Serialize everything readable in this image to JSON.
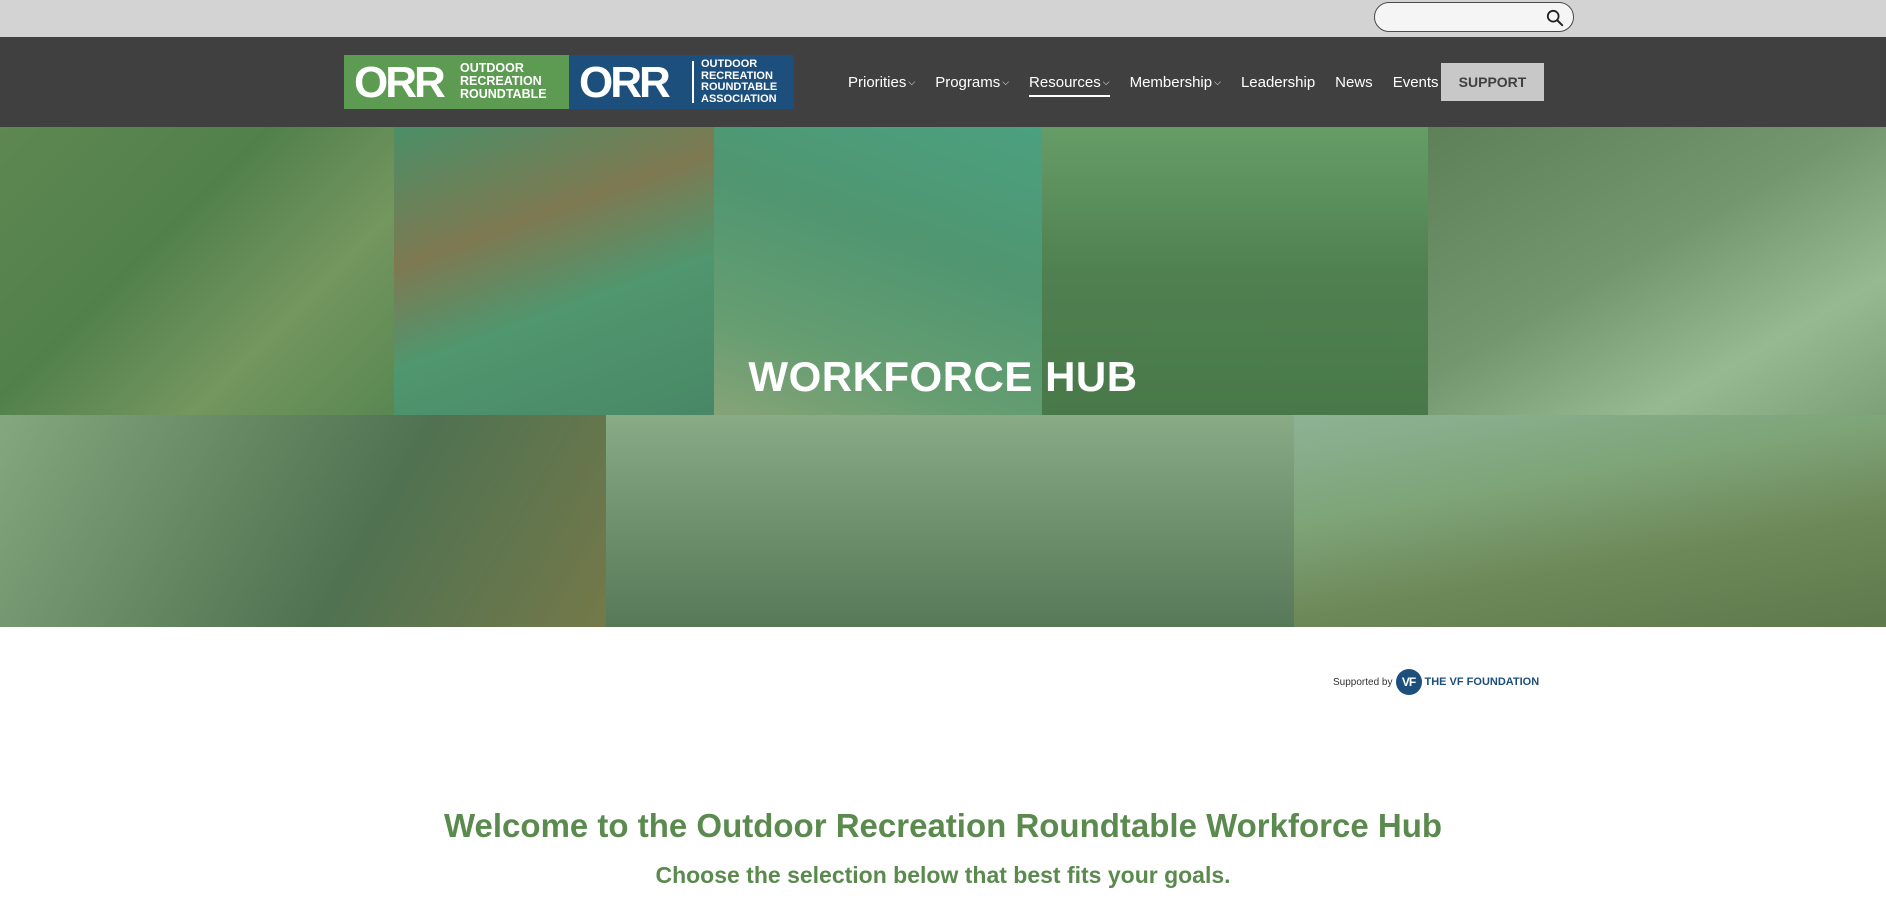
{
  "search": {
    "placeholder": "",
    "value": ""
  },
  "logos": {
    "orr": {
      "mark": "ORR",
      "words": [
        "OUTDOOR",
        "RECREATION",
        "ROUNDTABLE"
      ]
    },
    "orra": {
      "mark": "ORR",
      "words": [
        "OUTDOOR",
        "RECREATION",
        "ROUNDTABLE",
        "ASSOCIATION"
      ]
    }
  },
  "nav": {
    "items": [
      {
        "label": "Priorities",
        "dropdown": true,
        "active": false
      },
      {
        "label": "Programs",
        "dropdown": true,
        "active": false
      },
      {
        "label": "Resources",
        "dropdown": true,
        "active": true
      },
      {
        "label": "Membership",
        "dropdown": true,
        "active": false
      },
      {
        "label": "Leadership",
        "dropdown": false,
        "active": false
      },
      {
        "label": "News",
        "dropdown": false,
        "active": false
      },
      {
        "label": "Events",
        "dropdown": false,
        "active": false
      }
    ],
    "support_label": "SUPPORT"
  },
  "hero": {
    "title": "WORKFORCE HUB"
  },
  "supported_by": {
    "prefix": "Supported by",
    "mark": "VF",
    "name": "THE VF FOUNDATION"
  },
  "welcome": {
    "title": "Welcome to the Outdoor Recreation Roundtable Workforce Hub",
    "subtitle": "Choose the selection below that best fits your goals."
  },
  "colors": {
    "header_bg": "#404040",
    "utility_bg": "#d3d3d3",
    "orr_green": "#5d9a52",
    "orr_blue": "#1d4f7c",
    "heading_green": "#5a8a4e",
    "hero_overlay": "#62a064"
  }
}
